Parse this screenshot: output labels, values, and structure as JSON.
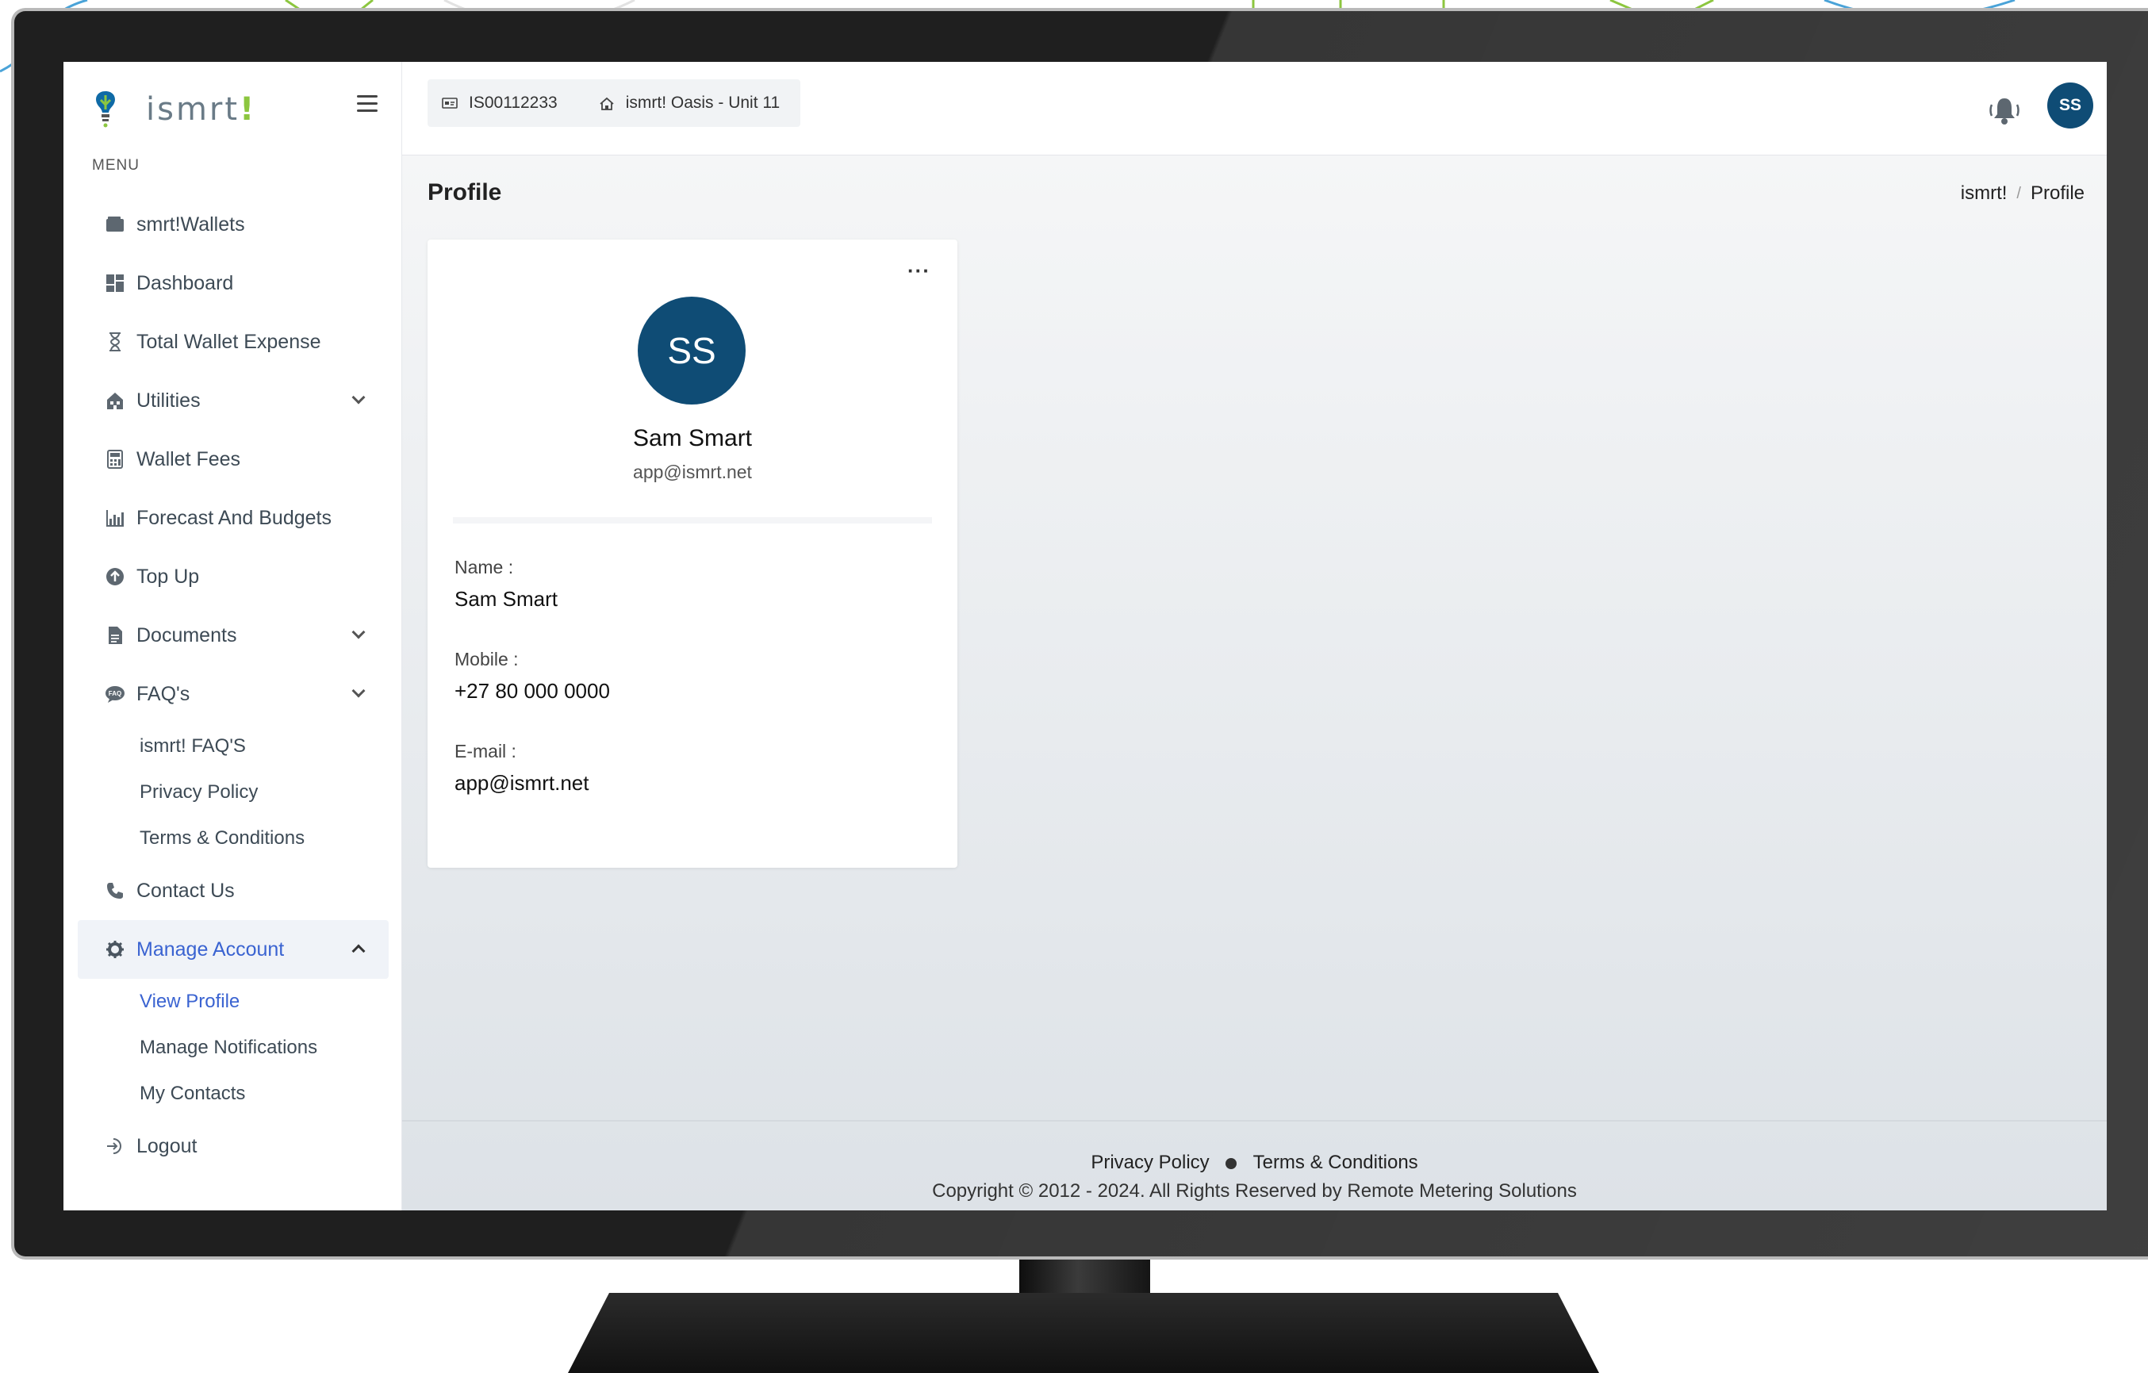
{
  "app": {
    "brand": "ismrt",
    "brand_bang": "!",
    "menu_heading": "MENU"
  },
  "sidebar": {
    "items": [
      {
        "label": "smrt!Wallets",
        "icon": "wallet-icon"
      },
      {
        "label": "Dashboard",
        "icon": "dashboard-icon"
      },
      {
        "label": "Total Wallet Expense",
        "icon": "hourglass-icon"
      },
      {
        "label": "Utilities",
        "icon": "building-icon"
      },
      {
        "label": "Wallet Fees",
        "icon": "calculator-icon"
      },
      {
        "label": "Forecast And Budgets",
        "icon": "chart-icon"
      },
      {
        "label": "Top Up",
        "icon": "arrow-up-circle-icon"
      },
      {
        "label": "Documents",
        "icon": "document-icon"
      },
      {
        "label": "FAQ's",
        "icon": "faq-chat-icon"
      },
      {
        "label": "Contact Us",
        "icon": "phone-icon"
      },
      {
        "label": "Manage Account",
        "icon": "gear-icon"
      },
      {
        "label": "Logout",
        "icon": "logout-icon"
      }
    ],
    "faq_sub": [
      "ismrt! FAQ'S",
      "Privacy Policy",
      "Terms & Conditions"
    ],
    "account_sub": [
      "View Profile",
      "Manage Notifications",
      "My Contacts"
    ]
  },
  "topbar": {
    "account_id": "IS00112233",
    "property": "ismrt! Oasis - Unit 11",
    "avatar_initials": "SS"
  },
  "page": {
    "title": "Profile",
    "breadcrumb": [
      "ismrt!",
      "Profile"
    ],
    "breadcrumb_sep": "/"
  },
  "profile": {
    "initials": "SS",
    "name": "Sam Smart",
    "email": "app@ismrt.net",
    "fields": [
      {
        "label": "Name :",
        "value": "Sam Smart"
      },
      {
        "label": "Mobile :",
        "value": "+27 80 000 0000"
      },
      {
        "label": "E-mail :",
        "value": "app@ismrt.net"
      }
    ],
    "more": "···"
  },
  "footer": {
    "privacy": "Privacy Policy",
    "terms": "Terms & Conditions",
    "copyright": "Copyright © 2012 - 2024.  All Rights Reserved by Remote Metering Solutions"
  },
  "colors": {
    "accent": "#3a63d1",
    "avatar": "#0f4c75",
    "brand_green": "#8cc63f"
  }
}
